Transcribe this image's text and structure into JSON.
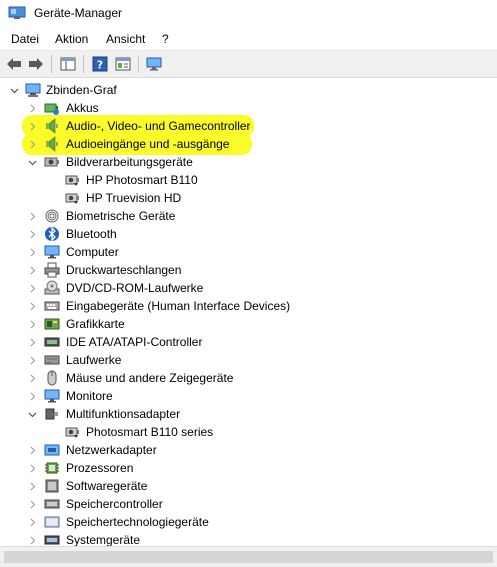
{
  "window": {
    "title": "Geräte-Manager"
  },
  "menu": [
    {
      "label": "Datei"
    },
    {
      "label": "Aktion"
    },
    {
      "label": "Ansicht"
    },
    {
      "label": "?"
    }
  ],
  "toolbar": {
    "buttons": [
      "back-arrow-icon",
      "forward-arrow-icon",
      "properties-icon",
      "help-icon",
      "device-view-icon",
      "monitor-scan-icon"
    ]
  },
  "tree": {
    "root": "Zbinden-Graf",
    "items": [
      {
        "label": "Akkus",
        "icon": "battery-icon",
        "state": "collapsed"
      },
      {
        "label": "Audio-, Video- und Gamecontroller",
        "icon": "speaker-icon",
        "state": "collapsed",
        "highlighted": true
      },
      {
        "label": "Audioeingänge und -ausgänge",
        "icon": "speaker-icon",
        "state": "collapsed",
        "highlighted": true
      },
      {
        "label": "Bildverarbeitungsgeräte",
        "icon": "camera-icon",
        "state": "expanded",
        "children": [
          {
            "label": "HP Photosmart B110",
            "icon": "camera-device-icon"
          },
          {
            "label": "HP Truevision HD",
            "icon": "camera-device-icon"
          }
        ]
      },
      {
        "label": "Biometrische Geräte",
        "icon": "fingerprint-icon",
        "state": "collapsed"
      },
      {
        "label": "Bluetooth",
        "icon": "bluetooth-icon",
        "state": "collapsed"
      },
      {
        "label": "Computer",
        "icon": "computer-icon",
        "state": "collapsed"
      },
      {
        "label": "Druckwarteschlangen",
        "icon": "printer-icon",
        "state": "collapsed"
      },
      {
        "label": "DVD/CD-ROM-Laufwerke",
        "icon": "disc-drive-icon",
        "state": "collapsed"
      },
      {
        "label": "Eingabegeräte (Human Interface Devices)",
        "icon": "hid-icon",
        "state": "collapsed"
      },
      {
        "label": "Grafikkarte",
        "icon": "graphics-card-icon",
        "state": "collapsed"
      },
      {
        "label": "IDE ATA/ATAPI-Controller",
        "icon": "ide-controller-icon",
        "state": "collapsed"
      },
      {
        "label": "Laufwerke",
        "icon": "drive-icon",
        "state": "collapsed"
      },
      {
        "label": "Mäuse und andere Zeigegeräte",
        "icon": "mouse-icon",
        "state": "collapsed"
      },
      {
        "label": "Monitore",
        "icon": "monitor-icon",
        "state": "collapsed"
      },
      {
        "label": "Multifunktionsadapter",
        "icon": "multifunction-icon",
        "state": "expanded",
        "children": [
          {
            "label": "Photosmart B110 series",
            "icon": "camera-device-icon"
          }
        ]
      },
      {
        "label": "Netzwerkadapter",
        "icon": "network-adapter-icon",
        "state": "collapsed"
      },
      {
        "label": "Prozessoren",
        "icon": "processor-icon",
        "state": "collapsed"
      },
      {
        "label": "Softwaregeräte",
        "icon": "software-device-icon",
        "state": "collapsed"
      },
      {
        "label": "Speichercontroller",
        "icon": "storage-controller-icon",
        "state": "collapsed"
      },
      {
        "label": "Speichertechnologiegeräte",
        "icon": "storage-tech-icon",
        "state": "collapsed"
      },
      {
        "label": "Systemgeräte",
        "icon": "system-device-icon",
        "state": "collapsed"
      }
    ]
  },
  "colors": {
    "highlight": "#fbfb2a",
    "accent": "#0078d7"
  }
}
